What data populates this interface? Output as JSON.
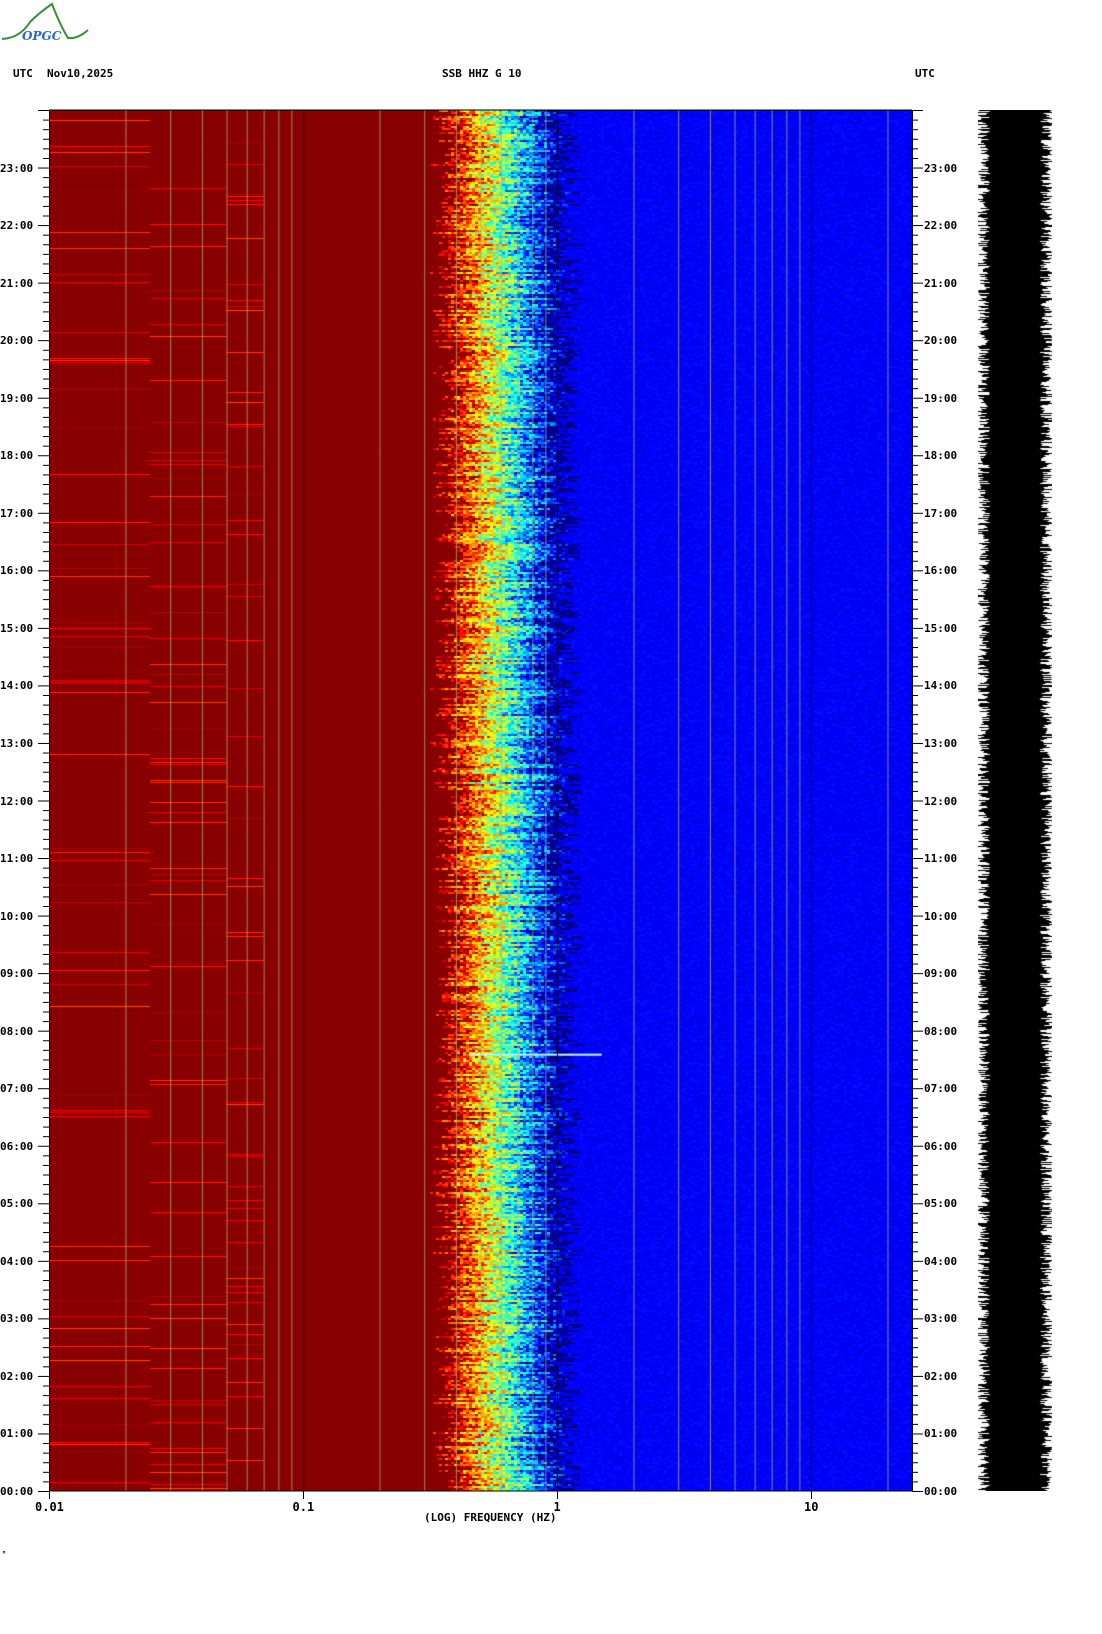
{
  "header": {
    "left_tz": "UTC",
    "date": "Nov10,2025",
    "station": "SSB HHZ G 10",
    "right_tz": "UTC",
    "logo_text": "OPGC"
  },
  "footer_mark": "ᴴ",
  "colors": {
    "low": "#880000",
    "high": "#000099",
    "grid": "#999999"
  },
  "chart_data": {
    "type": "heatmap",
    "title": "SSB HHZ G 10",
    "xlabel": "(LOG) FREQUENCY (HZ)",
    "ylabel": "UTC",
    "xscale": "log",
    "xlim": [
      0.01,
      25
    ],
    "ylim": [
      "00:00",
      "24:00"
    ],
    "x_ticks": [
      "0.01",
      "0.1",
      "1",
      "10"
    ],
    "y_ticks": [
      "00:00",
      "01:00",
      "02:00",
      "03:00",
      "04:00",
      "05:00",
      "06:00",
      "07:00",
      "08:00",
      "09:00",
      "10:00",
      "11:00",
      "12:00",
      "13:00",
      "14:00",
      "15:00",
      "16:00",
      "17:00",
      "18:00",
      "19:00",
      "20:00",
      "21:00",
      "22:00",
      "23:00"
    ],
    "colormap": "jet (high power red, low power blue)",
    "features": [
      {
        "label": "microseism band",
        "freq_range_hz": [
          0.3,
          0.8
        ]
      },
      {
        "label": "transient event",
        "time": "07:35",
        "freq_range_hz": [
          0.4,
          1.5
        ]
      }
    ]
  }
}
